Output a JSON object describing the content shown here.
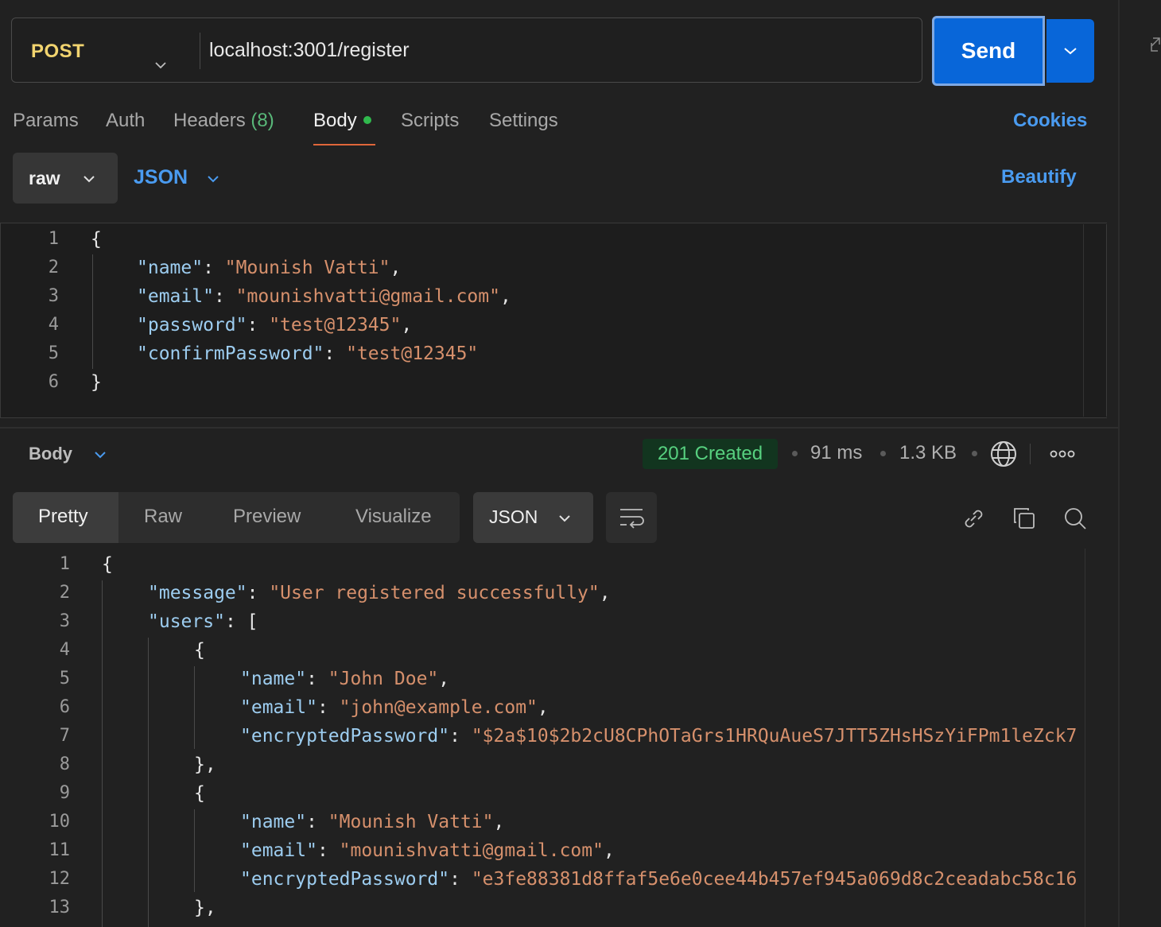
{
  "request": {
    "method": "POST",
    "url": "localhost:3001/register",
    "send_label": "Send"
  },
  "tabs": {
    "params": "Params",
    "auth": "Auth",
    "headers": "Headers",
    "headers_count": "(8)",
    "body": "Body",
    "scripts": "Scripts",
    "settings": "Settings",
    "cookies": "Cookies",
    "active": "Body"
  },
  "body_mode": {
    "mode": "raw",
    "format": "JSON",
    "beautify": "Beautify"
  },
  "request_body": {
    "lines": [
      {
        "n": "1",
        "parts": [
          [
            "p",
            "{"
          ]
        ]
      },
      {
        "n": "2",
        "parts": [
          [
            "k",
            "\"name\""
          ],
          [
            "p",
            ": "
          ],
          [
            "s",
            "\"Mounish Vatti\""
          ],
          [
            "p",
            ","
          ]
        ]
      },
      {
        "n": "3",
        "parts": [
          [
            "k",
            "\"email\""
          ],
          [
            "p",
            ": "
          ],
          [
            "s",
            "\"mounishvatti@gmail.com\""
          ],
          [
            "p",
            ","
          ]
        ]
      },
      {
        "n": "4",
        "parts": [
          [
            "k",
            "\"password\""
          ],
          [
            "p",
            ": "
          ],
          [
            "s",
            "\"test@12345\""
          ],
          [
            "p",
            ","
          ]
        ]
      },
      {
        "n": "5",
        "parts": [
          [
            "k",
            "\"confirmPassword\""
          ],
          [
            "p",
            ": "
          ],
          [
            "s",
            "\"test@12345\""
          ]
        ]
      },
      {
        "n": "6",
        "parts": [
          [
            "p",
            "}"
          ]
        ]
      }
    ]
  },
  "response": {
    "section_label": "Body",
    "status": "201 Created",
    "time": "91 ms",
    "size": "1.3 KB",
    "status_color": "#57d07f",
    "view_tabs": [
      "Pretty",
      "Raw",
      "Preview",
      "Visualize"
    ],
    "active_view": "Pretty",
    "format": "JSON",
    "lines": [
      {
        "n": "1",
        "parts": [
          [
            "p",
            "{"
          ]
        ]
      },
      {
        "n": "2",
        "parts": [
          [
            "k",
            "\"message\""
          ],
          [
            "p",
            ": "
          ],
          [
            "s",
            "\"User registered successfully\""
          ],
          [
            "p",
            ","
          ]
        ]
      },
      {
        "n": "3",
        "parts": [
          [
            "k",
            "\"users\""
          ],
          [
            "p",
            ": ["
          ]
        ]
      },
      {
        "n": "4",
        "parts": [
          [
            "p",
            "{"
          ]
        ]
      },
      {
        "n": "5",
        "parts": [
          [
            "k",
            "\"name\""
          ],
          [
            "p",
            ": "
          ],
          [
            "s",
            "\"John Doe\""
          ],
          [
            "p",
            ","
          ]
        ]
      },
      {
        "n": "6",
        "parts": [
          [
            "k",
            "\"email\""
          ],
          [
            "p",
            ": "
          ],
          [
            "s",
            "\"john@example.com\""
          ],
          [
            "p",
            ","
          ]
        ]
      },
      {
        "n": "7",
        "parts": [
          [
            "k",
            "\"encryptedPassword\""
          ],
          [
            "p",
            ": "
          ],
          [
            "s",
            "\"$2a$10$2b2cU8CPhOTaGrs1HRQuAueS7JTT5ZHsHSzYiFPm1leZck7"
          ]
        ]
      },
      {
        "n": "8",
        "parts": [
          [
            "p",
            "},"
          ]
        ]
      },
      {
        "n": "9",
        "parts": [
          [
            "p",
            "{"
          ]
        ]
      },
      {
        "n": "10",
        "parts": [
          [
            "k",
            "\"name\""
          ],
          [
            "p",
            ": "
          ],
          [
            "s",
            "\"Mounish Vatti\""
          ],
          [
            "p",
            ","
          ]
        ]
      },
      {
        "n": "11",
        "parts": [
          [
            "k",
            "\"email\""
          ],
          [
            "p",
            ": "
          ],
          [
            "s",
            "\"mounishvatti@gmail.com\""
          ],
          [
            "p",
            ","
          ]
        ]
      },
      {
        "n": "12",
        "parts": [
          [
            "k",
            "\"encryptedPassword\""
          ],
          [
            "p",
            ": "
          ],
          [
            "s",
            "\"e3fe88381d8ffaf5e6e0cee44b457ef945a069d8c2ceadabc58c16"
          ]
        ]
      },
      {
        "n": "13",
        "parts": [
          [
            "p",
            "},"
          ]
        ]
      }
    ]
  },
  "icons": {
    "method_dropdown": "chevron-down-icon",
    "send_dropdown": "chevron-down-icon",
    "expand": "expand-icon",
    "globe": "globe-icon",
    "more": "more-horizontal-icon",
    "wrap": "wrap-lines-icon",
    "link": "link-icon",
    "copy": "copy-icon",
    "search": "search-icon"
  },
  "colors": {
    "accent": "#0866d9",
    "link": "#4a9bf0",
    "method": "#f2d46f",
    "json_key": "#9dcdf0",
    "json_string": "#d6906c"
  }
}
